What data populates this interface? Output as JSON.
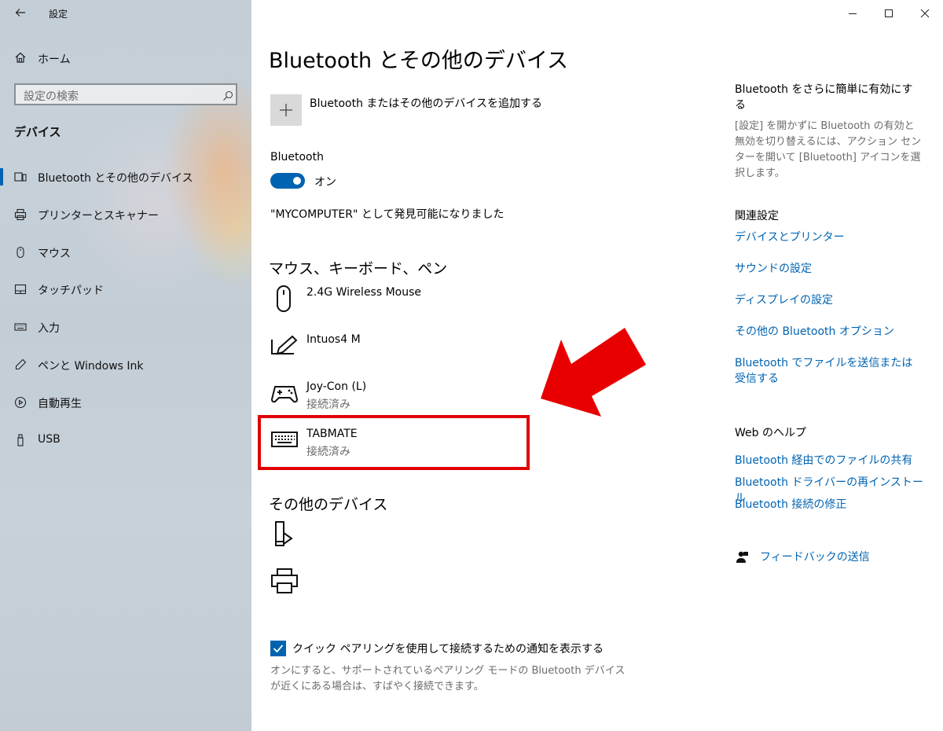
{
  "window": {
    "title": "設定"
  },
  "sidebar": {
    "home": "ホーム",
    "search_placeholder": "設定の検索",
    "section": "デバイス",
    "items": [
      {
        "label": "Bluetooth とその他のデバイス",
        "icon": "bluetooth-devices-icon",
        "selected": true
      },
      {
        "label": "プリンターとスキャナー",
        "icon": "printer-icon"
      },
      {
        "label": "マウス",
        "icon": "mouse-icon"
      },
      {
        "label": "タッチパッド",
        "icon": "touchpad-icon"
      },
      {
        "label": "入力",
        "icon": "keyboard-icon"
      },
      {
        "label": "ペンと Windows Ink",
        "icon": "pen-icon"
      },
      {
        "label": "自動再生",
        "icon": "autoplay-icon"
      },
      {
        "label": "USB",
        "icon": "usb-icon"
      }
    ]
  },
  "main": {
    "title": "Bluetooth とその他のデバイス",
    "add_device": "Bluetooth またはその他のデバイスを追加する",
    "bluetooth_label": "Bluetooth",
    "bluetooth_state": "オン",
    "bluetooth_on": true,
    "discoverable": "\"MYCOMPUTER\" として発見可能になりました",
    "group_mouse": "マウス、キーボード、ペン",
    "devices": [
      {
        "name": "2.4G Wireless Mouse",
        "status": "",
        "icon": "mouse-icon"
      },
      {
        "name": "Intuos4 M",
        "status": "",
        "icon": "pen-tablet-icon"
      },
      {
        "name": "Joy-Con (L)",
        "status": "接続済み",
        "icon": "gamepad-icon"
      },
      {
        "name": "TABMATE",
        "status": "接続済み",
        "icon": "keyboard-icon"
      }
    ],
    "group_other": "その他のデバイス",
    "other_devices": [
      {
        "icon": "media-device-icon"
      },
      {
        "icon": "printer-icon"
      }
    ],
    "quick_pair_label": "クイック ペアリングを使用して接続するための通知を表示する",
    "quick_pair_checked": true,
    "quick_pair_hint": "オンにすると、サポートされているペアリング モードの Bluetooth デバイスが近くにある場合は、すばやく接続できます。"
  },
  "right": {
    "tip_title": "Bluetooth をさらに簡単に有効にする",
    "tip_text": "[設定] を開かずに Bluetooth の有効と無効を切り替えるには、アクション センターを開いて [Bluetooth] アイコンを選択します。",
    "related_title": "関連設定",
    "related_links": [
      "デバイスとプリンター",
      "サウンドの設定",
      "ディスプレイの設定",
      "その他の Bluetooth オプション",
      "Bluetooth でファイルを送信または受信する"
    ],
    "help_title": "Web のヘルプ",
    "help_links": [
      "Bluetooth 経由でのファイルの共有",
      "Bluetooth ドライバーの再インストール",
      "Bluetooth 接続の修正"
    ],
    "feedback": "フィードバックの送信"
  },
  "colors": {
    "accent": "#0063b1",
    "annotation": "#e00000"
  }
}
